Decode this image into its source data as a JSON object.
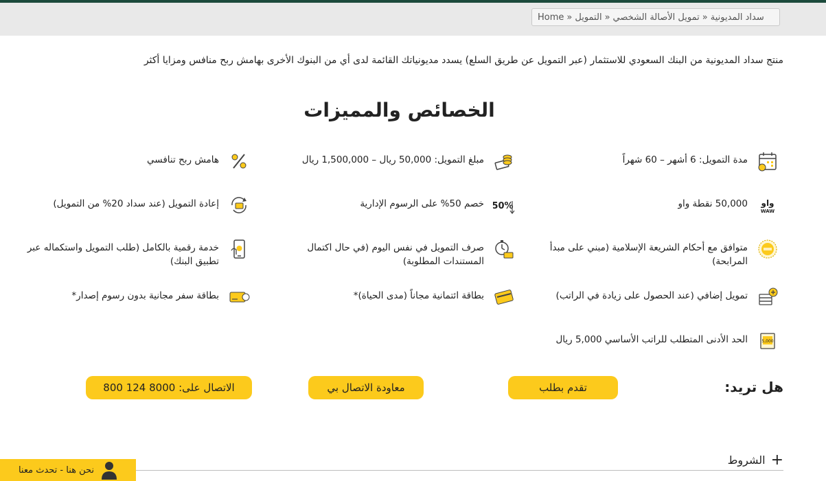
{
  "breadcrumb": {
    "home": "Home",
    "sep": "»",
    "level1": "التمويل",
    "level2": "تمويل الأصالة الشخصي",
    "current": "سداد المديونية"
  },
  "intro": "منتج سداد المديونية من البنك السعودي للاستثمار (عبر التمويل عن طريق السلع) يسدد مديونياتك القائمة لدى أي من البنوك الأخرى بهامش ربح منافس ومزايا أكثر",
  "section_title": "الخصائص والمميزات",
  "features": [
    {
      "icon": "calendar-icon",
      "text": "مدة التمويل: 6 أشهر – 60 شهراً"
    },
    {
      "icon": "coins-stack-icon",
      "text": "مبلغ التمويل: 50,000 ريال – 1,500,000 ريال"
    },
    {
      "icon": "percent-icon",
      "text": "هامش ربح تنافسي"
    },
    {
      "icon": "waw-logo-icon",
      "text": "50,000 نقطة واو"
    },
    {
      "icon": "discount-50-icon",
      "text": "خصم 50% على الرسوم الإدارية"
    },
    {
      "icon": "refinance-icon",
      "text": "إعادة التمويل (عند سداد 20% من التمويل)"
    },
    {
      "icon": "sharia-badge-icon",
      "text": "متوافق مع أحكام الشريعة الإسلامية (مبني على مبدأ المرابحة)"
    },
    {
      "icon": "stopwatch-money-icon",
      "text": "صرف التمويل في نفس اليوم (في حال اكتمال المستندات المطلوبة)"
    },
    {
      "icon": "mobile-app-icon",
      "text": "خدمة رقمية بالكامل (طلب التمويل واستكماله عبر تطبيق البنك)"
    },
    {
      "icon": "additional-finance-icon",
      "text": "تمويل إضافي (عند الحصول على زيادة في الراتب)"
    },
    {
      "icon": "credit-card-icon",
      "text": "بطاقة ائتمانية مجاناً (مدى الحياة)*"
    },
    {
      "icon": "travel-card-icon",
      "text": "بطاقة سفر مجانية بدون رسوم إصدار*"
    },
    {
      "icon": "salary-note-icon",
      "text": "الحد الأدنى المتطلب للراتب الأساسي 5,000 ريال"
    }
  ],
  "cta": {
    "label": "هل تريد:",
    "apply": "تقدم بطلب",
    "callback": "معاودة الاتصال بي",
    "call": "الاتصال على: 8000 124 800"
  },
  "terms": {
    "plus": "+",
    "label": "الشروط"
  },
  "chat": {
    "label": "نحن هنا - تحدث معنا"
  },
  "colors": {
    "accent": "#fcca1c",
    "header_strip": "#1c4a3c",
    "gray_bar": "#e9e9e9"
  }
}
